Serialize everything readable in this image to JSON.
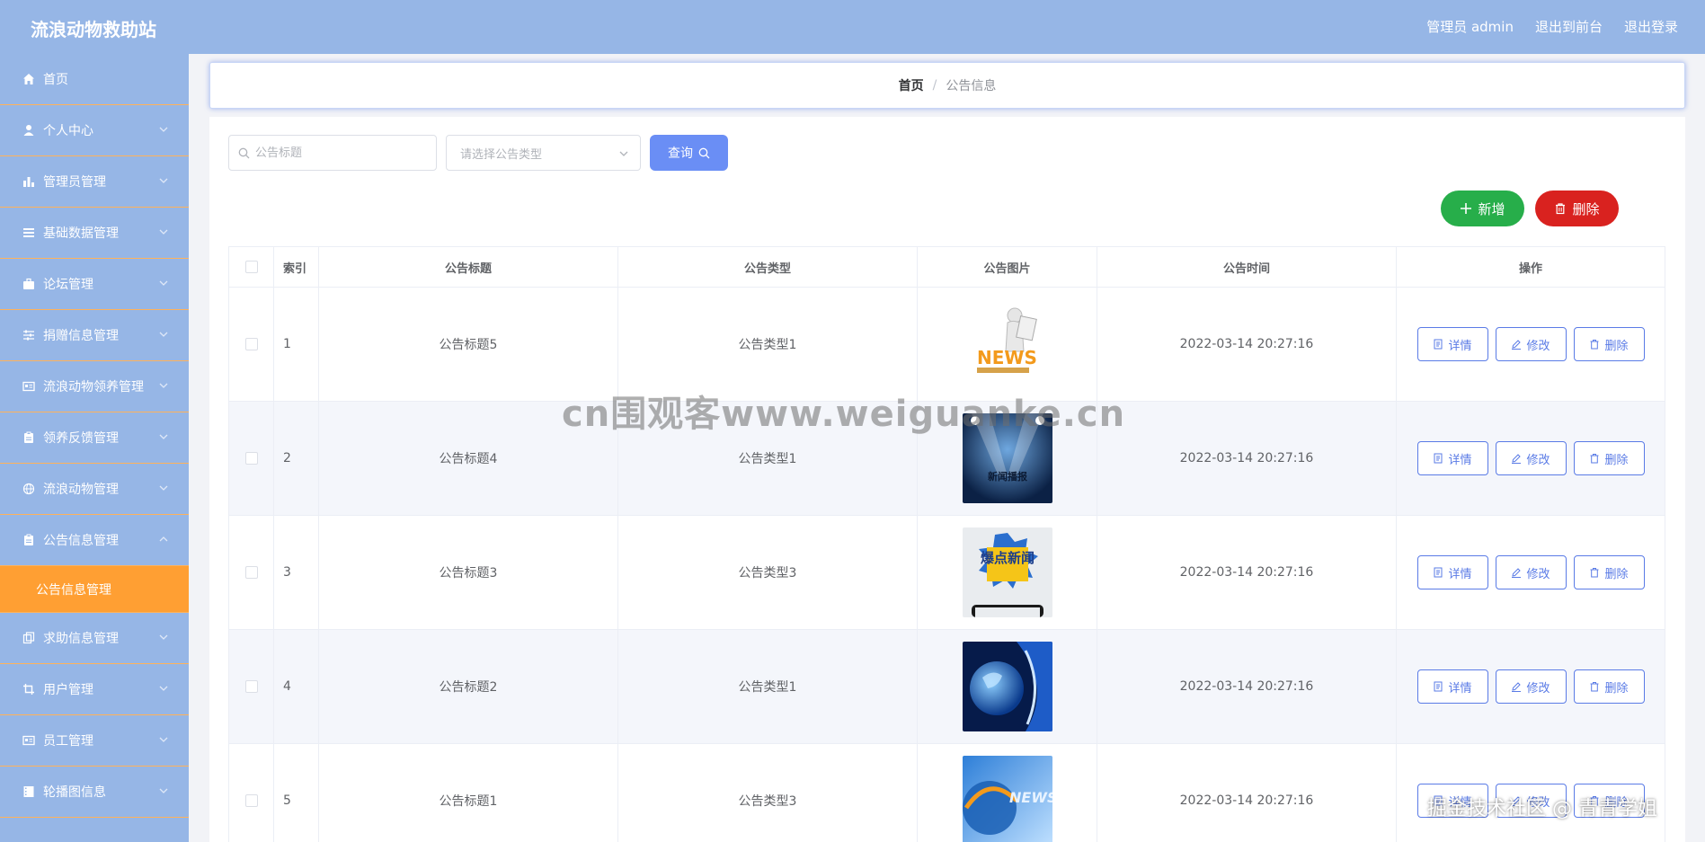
{
  "header": {
    "app_title": "流浪动物救助站",
    "links": [
      "管理员 admin",
      "退出到前台",
      "退出登录"
    ]
  },
  "sidebar": {
    "items": [
      {
        "label": "首页",
        "icon": "home-icon"
      },
      {
        "label": "个人中心",
        "icon": "user-icon"
      },
      {
        "label": "管理员管理",
        "icon": "bar-chart-icon"
      },
      {
        "label": "基础数据管理",
        "icon": "list-icon"
      },
      {
        "label": "论坛管理",
        "icon": "briefcase-icon"
      },
      {
        "label": "捐赠信息管理",
        "icon": "sliders-icon"
      },
      {
        "label": "流浪动物领养管理",
        "icon": "id-card-icon"
      },
      {
        "label": "领养反馈管理",
        "icon": "clipboard-icon"
      },
      {
        "label": "流浪动物管理",
        "icon": "globe-icon"
      },
      {
        "label": "公告信息管理",
        "icon": "clipboard-icon"
      }
    ],
    "active_sub": "公告信息管理",
    "items_after": [
      {
        "label": "求助信息管理",
        "icon": "copy-icon"
      },
      {
        "label": "用户管理",
        "icon": "crop-icon"
      },
      {
        "label": "员工管理",
        "icon": "id-card-icon"
      },
      {
        "label": "轮播图信息",
        "icon": "film-icon"
      }
    ]
  },
  "breadcrumb": {
    "home": "首页",
    "separator": "/",
    "current": "公告信息"
  },
  "search": {
    "title_placeholder": "公告标题",
    "type_placeholder": "请选择公告类型",
    "query_label": "查询"
  },
  "actions": {
    "add_label": "新增",
    "delete_label": "删除"
  },
  "table": {
    "columns": [
      "索引",
      "公告标题",
      "公告类型",
      "公告图片",
      "公告时间",
      "操作"
    ],
    "rows": [
      {
        "index": "1",
        "title": "公告标题5",
        "type": "公告类型1",
        "time": "2022-03-14 20:27:16",
        "image": "news-3d-figure"
      },
      {
        "index": "2",
        "title": "公告标题4",
        "type": "公告类型1",
        "time": "2022-03-14 20:27:16",
        "image": "news-spotlight",
        "image_text": "新闻播报"
      },
      {
        "index": "3",
        "title": "公告标题3",
        "type": "公告类型3",
        "time": "2022-03-14 20:27:16",
        "image": "breaking-news-badge",
        "image_text": "爆点新闻"
      },
      {
        "index": "4",
        "title": "公告标题2",
        "type": "公告类型1",
        "time": "2022-03-14 20:27:16",
        "image": "blue-globe"
      },
      {
        "index": "5",
        "title": "公告标题1",
        "type": "公告类型3",
        "time": "2022-03-14 20:27:16",
        "image": "news-globe-orange"
      }
    ],
    "row_actions": {
      "detail": "详情",
      "edit": "修改",
      "delete": "删除"
    }
  },
  "watermark": "cn围观客www.weiguanke.cn",
  "footer_mark": "掘金技术社区 @ 青青学姐",
  "colors": {
    "header_bg": "#96b6e6",
    "sidebar_bg": "#96b6e6",
    "active_item": "#ff9f33",
    "primary": "#6a8ef5",
    "success": "#27ae4a",
    "danger": "#d9221f"
  }
}
